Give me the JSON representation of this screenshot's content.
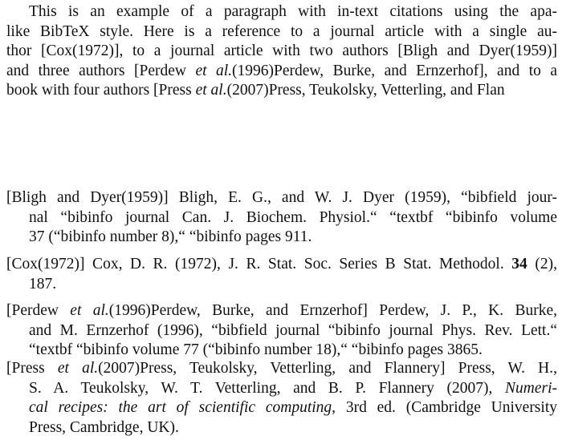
{
  "paragraph": {
    "lines": [
      "This is an example of a paragraph with in-text citations using the apa-",
      "like BibTeX style.  Here is a reference to a journal article with a single au-",
      "thor [Cox(1972)], to a journal article with two authors [Bligh and Dyer(1959)]",
      "and three authors [Perdew ",
      "book with four authors [Press "
    ],
    "line4": {
      "pre": "and three authors [Perdew ",
      "it": "et al.",
      "post": "(1996)Perdew, Burke, and Ernzerhof], and to a"
    },
    "line5": {
      "pre": "book with four authors [Press ",
      "it": "et al.",
      "post": "(2007)Press, Teukolsky, Vetterling, and Flan"
    }
  },
  "bibliography": [
    {
      "key": "[Bligh and Dyer(1959)]",
      "lines": [
        " Bligh, E. G.,  and W. J. Dyer (1959), “bibfield jour-",
        "nal “bibinfo journal Can. J. Biochem. Physiol.“ “textbf “bibinfo volume",
        "37 (“bibinfo number 8),“ “bibinfo pages 911."
      ]
    },
    {
      "key": "[Cox(1972)]",
      "line1_pre": "  Cox, D. R. (1972), J. R. Stat. Soc. Series B Stat. Methodol. ",
      "line1_bold": "34",
      "line1_post": " (2),",
      "line2": "187."
    },
    {
      "key_pre": "[Perdew ",
      "key_it": "et al.",
      "key_post": "(1996)Perdew, Burke, and Ernzerhof]",
      "line1_rest": "  Perdew,  J. P.,  K. Burke,",
      "line2": "and M. Ernzerhof (1996), “bibfield journal “bibinfo journal Phys. Rev. Lett.“",
      "line3": "“textbf “bibinfo volume 77 (“bibinfo number 18),“ “bibinfo pages 3865."
    },
    {
      "key_pre": "[Press ",
      "key_it": "et al.",
      "key_post": "(2007)Press, Teukolsky, Vetterling, and Flannery]",
      "line1_rest": "  Press,   W.   H.,",
      "line2": "S. A. Teukolsky, W. T. Vetterling,  and B. P. Flannery (2007), ",
      "line2_it": "Numeri-",
      "line3_it": "cal recipes: the art of scientific computing",
      "line3_post": ", 3rd ed. (Cambridge University",
      "line4": "Press, Cambridge, UK)."
    }
  ]
}
